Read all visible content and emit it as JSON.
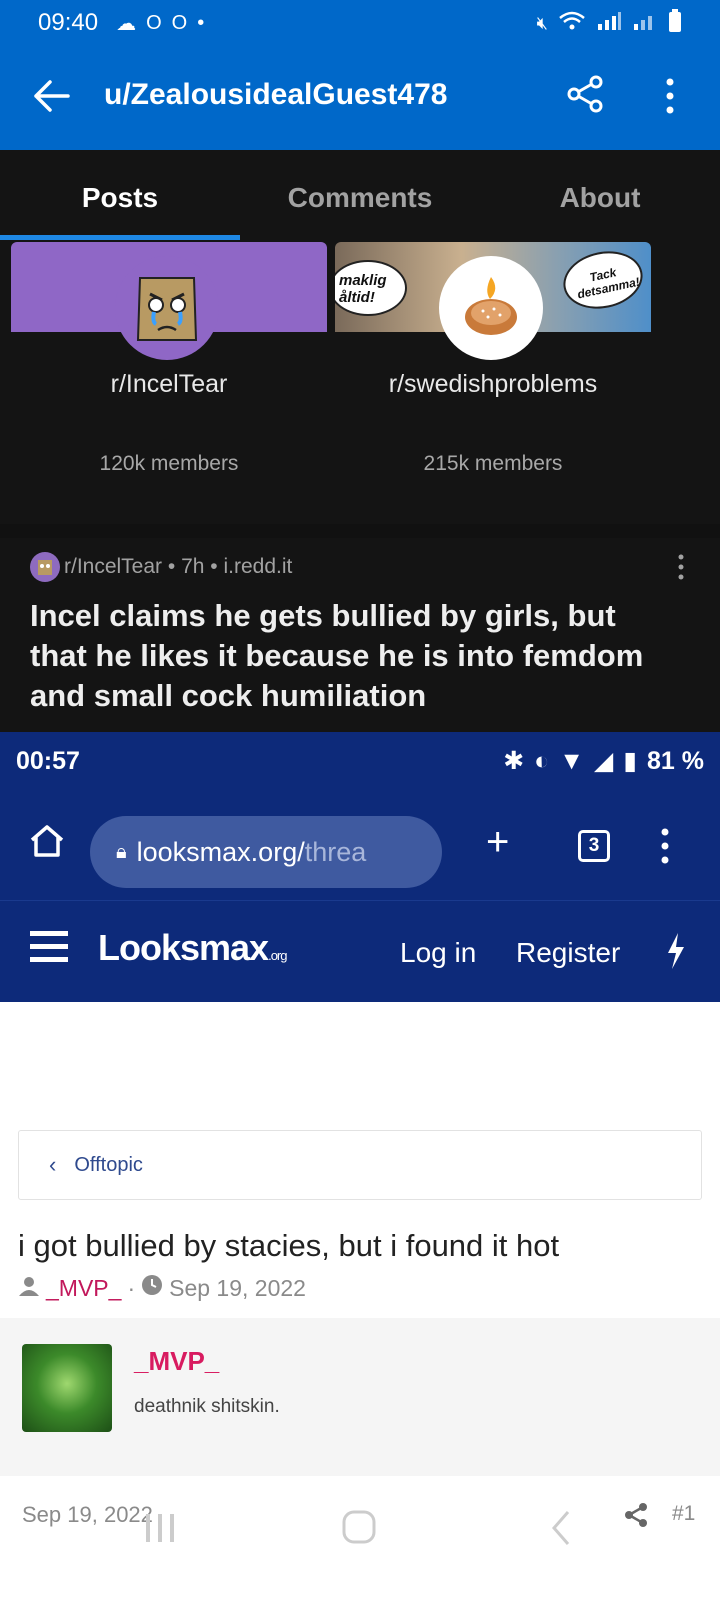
{
  "status_bar": {
    "time": "09:40"
  },
  "app_bar": {
    "title": "u/ZealousidealGuest478"
  },
  "tabs": [
    {
      "label": "Posts",
      "active": true
    },
    {
      "label": "Comments",
      "active": false
    },
    {
      "label": "About",
      "active": false
    }
  ],
  "communities": [
    {
      "name": "r/IncelTear",
      "members": "120k members",
      "banner_color": "#8f67c6"
    },
    {
      "name": "r/swedishproblems",
      "members": "215k members",
      "banner_text_left": "maklig åltid!",
      "banner_text_right": "Tack detsamma!"
    }
  ],
  "post": {
    "subreddit": "r/IncelTear",
    "age": "7h",
    "source": "i.redd.it",
    "title": "Incel claims he gets bullied by girls, but that he likes it because he is into femdom and small cock humiliation"
  },
  "embedded": {
    "status_time": "00:57",
    "battery": "81 %",
    "url_main": "looksmax.org/",
    "url_dim": "threa",
    "tab_count": "3",
    "site_logo": "Looksmax",
    "site_logo_suffix": ".org",
    "login": "Log in",
    "register": "Register",
    "breadcrumb": "Offtopic",
    "thread_title": "i got bullied by stacies, but i found it hot",
    "thread_author": "_MVP_",
    "thread_date": "Sep 19, 2022",
    "message_author": "_MVP_",
    "message_user_title": "deathnik shitskin.",
    "post_date": "Sep 19, 2022",
    "post_number": "#1"
  },
  "colors": {
    "reddit_blue": "#0068c9",
    "dark_bg": "#141414",
    "site_navy": "#0d2a7a",
    "accent_pink": "#d81b60"
  }
}
